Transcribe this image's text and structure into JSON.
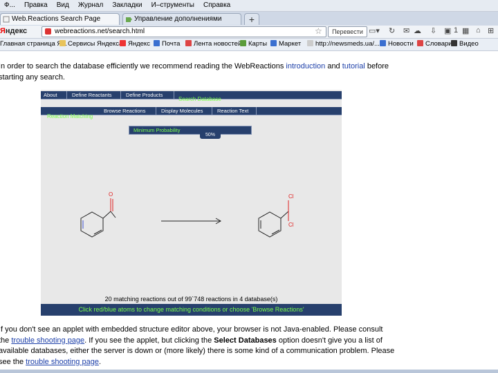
{
  "menu": [
    "Ф...",
    "Правка",
    "Вид",
    "Журнал",
    "Закладки",
    "И–струменты",
    "Справка"
  ],
  "tabs": [
    {
      "label": "Web.Reactions Search Page"
    },
    {
      "label": "Управление дополнениями"
    }
  ],
  "tab_new": "+",
  "nav": {
    "search_brand_first": "Я",
    "search_brand_rest": "ндекс",
    "url": "webreactions.net/search.html",
    "translate_label": "Перевести",
    "counter": "1"
  },
  "bookmarks": [
    "Главная страница Я...",
    "Сервисы Яндекса",
    "Яндекс",
    "Почта",
    "Лента новостей",
    "Карты",
    "Маркет",
    "http://newsmeds.ua/...",
    "Новости",
    "Словари",
    "Видео"
  ],
  "intro": {
    "line1_pre": "In order to search the database efficiently we recommend reading the WebReactions ",
    "line1_link1": "introduction",
    "line1_mid": " and ",
    "line1_link2": "tutorial",
    "line1_post": " before",
    "line2": "starting any search."
  },
  "applet": {
    "top_tabs": [
      "About",
      "Define Reactants",
      "Define Products"
    ],
    "search_tab": "Search Database",
    "left_tab": "Reaction Matching",
    "sub_tabs": [
      "Browse Reactions",
      "Display Molecules",
      "Reaction Text"
    ],
    "similarity_label": "Minimum Probability",
    "similarity_value": "50%",
    "status": "20 matching reactions out of 99`748 reactions in 4 database(s)",
    "hint": "Click red/blue atoms to change matching conditions or choose 'Browse Reactions'"
  },
  "outro": {
    "l1_a": "If you don't see an applet with embedded structure editor above, your browser is not Java-enabled. Please consult",
    "l2_a": "the ",
    "l2_link": "trouble shooting page",
    "l2_b": ". If you see the applet, but clicking the ",
    "l2_bold": "Select Databases",
    "l2_c": " option doesn't give you a list of",
    "l3": "available databases, either the server is down or (more likely) there is some kind of a communication problem. Please",
    "l4_a": "see the ",
    "l4_link": "trouble shooting page",
    "l4_b": "."
  },
  "colors": {
    "applet_bar": "#27406d",
    "applet_green_text": "#7cff4a",
    "link_blue": "#1b3ea8",
    "atom_red": "#e02020"
  }
}
